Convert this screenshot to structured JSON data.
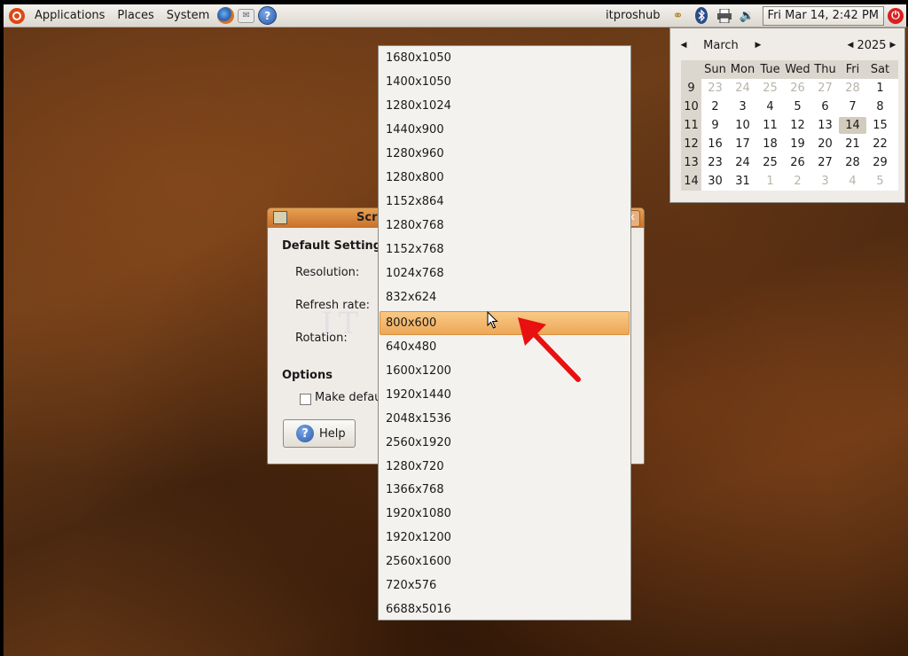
{
  "panel": {
    "menus": [
      "Applications",
      "Places",
      "System"
    ],
    "launchers": [
      "firefox-icon",
      "mail-icon",
      "help-icon"
    ],
    "username": "itproshub",
    "clock": "Fri Mar 14,  2:42 PM",
    "tray_icons": [
      "network-icon",
      "bluetooth-icon",
      "printer-icon",
      "volume-icon"
    ]
  },
  "calendar": {
    "month": "March",
    "year": "2025",
    "weekdays": [
      "Sun",
      "Mon",
      "Tue",
      "Wed",
      "Thu",
      "Fri",
      "Sat"
    ],
    "weeks": [
      {
        "num": "9",
        "days": [
          "23",
          "24",
          "25",
          "26",
          "27",
          "28",
          "1"
        ],
        "dim": [
          true,
          true,
          true,
          true,
          true,
          true,
          false
        ]
      },
      {
        "num": "10",
        "days": [
          "2",
          "3",
          "4",
          "5",
          "6",
          "7",
          "8"
        ],
        "dim": [
          false,
          false,
          false,
          false,
          false,
          false,
          false
        ]
      },
      {
        "num": "11",
        "days": [
          "9",
          "10",
          "11",
          "12",
          "13",
          "14",
          "15"
        ],
        "dim": [
          false,
          false,
          false,
          false,
          false,
          false,
          false
        ]
      },
      {
        "num": "12",
        "days": [
          "16",
          "17",
          "18",
          "19",
          "20",
          "21",
          "22"
        ],
        "dim": [
          false,
          false,
          false,
          false,
          false,
          false,
          false
        ]
      },
      {
        "num": "13",
        "days": [
          "23",
          "24",
          "25",
          "26",
          "27",
          "28",
          "29"
        ],
        "dim": [
          false,
          false,
          false,
          false,
          false,
          false,
          false
        ]
      },
      {
        "num": "14",
        "days": [
          "30",
          "31",
          "1",
          "2",
          "3",
          "4",
          "5"
        ],
        "dim": [
          false,
          false,
          true,
          true,
          true,
          true,
          true
        ]
      }
    ],
    "selected_day": "14"
  },
  "dialog": {
    "title": "Scr",
    "section_default": "Default Setting",
    "resolution_label": "Resolution:",
    "refresh_label": "Refresh rate:",
    "rotation_label": "Rotation:",
    "section_options": "Options",
    "make_default_label": "Make defau",
    "help_button": "Help"
  },
  "resolutions": {
    "items": [
      "1680x1050",
      "1400x1050",
      "1280x1024",
      "1440x900",
      "1280x960",
      "1280x800",
      "1152x864",
      "1280x768",
      "1152x768",
      "1024x768",
      "832x624",
      "800x600",
      "640x480",
      "1600x1200",
      "1920x1440",
      "2048x1536",
      "2560x1920",
      "1280x720",
      "1366x768",
      "1920x1080",
      "1920x1200",
      "2560x1600",
      "720x576",
      "6688x5016"
    ],
    "selected": "800x600"
  },
  "colors": {
    "highlight": "#eca858",
    "annotation_arrow": "#e81010",
    "titlebar": "#c8702a"
  }
}
